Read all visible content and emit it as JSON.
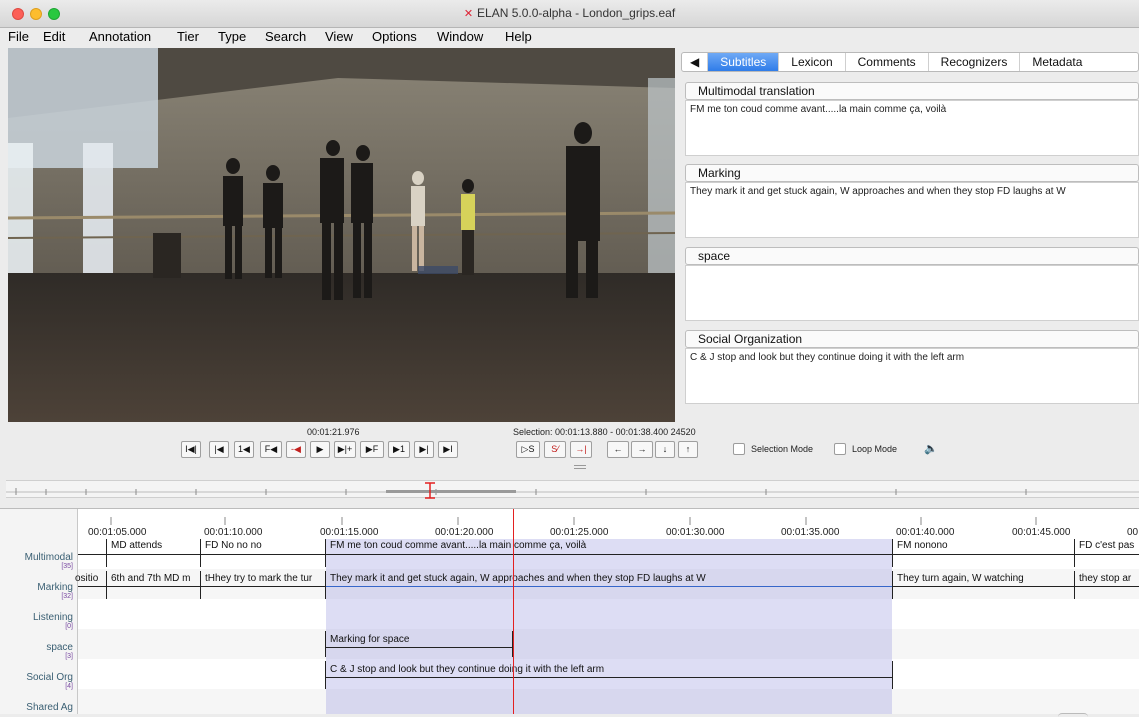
{
  "window": {
    "title": "ELAN 5.0.0-alpha - London_grips.eaf"
  },
  "menu": [
    "File",
    "Edit",
    "Annotation",
    "Tier",
    "Type",
    "Search",
    "View",
    "Options",
    "Window",
    "Help"
  ],
  "tabs": {
    "nav_arrow": "◀",
    "items": [
      "Subtitles",
      "Lexicon",
      "Comments",
      "Recognizers",
      "Metadata"
    ],
    "active": "Subtitles"
  },
  "subtitle_panels": [
    {
      "header": "Multimodal translation",
      "text": "FM me ton coud comme avant.....la main comme ça, voilà"
    },
    {
      "header": "Marking",
      "text": "They mark it and get stuck again, W approaches and when they stop FD laughs at W"
    },
    {
      "header": "space",
      "text": ""
    },
    {
      "header": "Social Organization",
      "text": "C & J stop and look but they continue doing it with the left arm"
    }
  ],
  "transport": {
    "media_time": "00:01:21.976",
    "selection": "Selection: 00:01:13.880 - 00:01:38.400  24520",
    "buttons": [
      "I◀|",
      "|◀",
      "1◀",
      "F◀",
      "-◀",
      "▶",
      "▶|+",
      "▶F",
      "▶1",
      "▶|",
      "▶I"
    ],
    "selection_buttons": [
      "▷S",
      "S⁄",
      "→|"
    ],
    "nav_buttons": [
      "←",
      "→",
      "↓",
      "↑"
    ],
    "selection_mode": "Selection Mode",
    "loop_mode": "Loop Mode",
    "volume_icon": "speaker-icon"
  },
  "ruler": {
    "ticks": [
      "00:01:05.000",
      "00:01:10.000",
      "00:01:15.000",
      "00:01:20.000",
      "00:01:25.000",
      "00:01:30.000",
      "00:01:35.000",
      "00:01:40.000",
      "00:01:45.000",
      "00"
    ]
  },
  "tiers": [
    {
      "name": "Multimodal",
      "count": "[35]"
    },
    {
      "name": "Marking",
      "count": "[32]"
    },
    {
      "name": "Listening",
      "count": "[0]"
    },
    {
      "name": "space",
      "count": "[3]"
    },
    {
      "name": "Social Org",
      "count": "[4]"
    },
    {
      "name": "Shared Ag",
      "count": ""
    }
  ],
  "annotations": {
    "multimodal": [
      "MD attends",
      "FD No no no",
      "FM me ton coud comme avant.....la main comme ça, voilà",
      "FM nonono",
      "FD c'est pas"
    ],
    "marking": [
      "ositio",
      "6th and 7th MD m",
      "tHhey try to mark the tur",
      "They mark it and get stuck again, W approaches and when they stop FD laughs at W",
      "They turn again, W watching",
      "they stop ar"
    ],
    "space": [
      "Marking for space"
    ],
    "social": [
      "C & J stop and look but they continue doing it with the left arm"
    ]
  }
}
